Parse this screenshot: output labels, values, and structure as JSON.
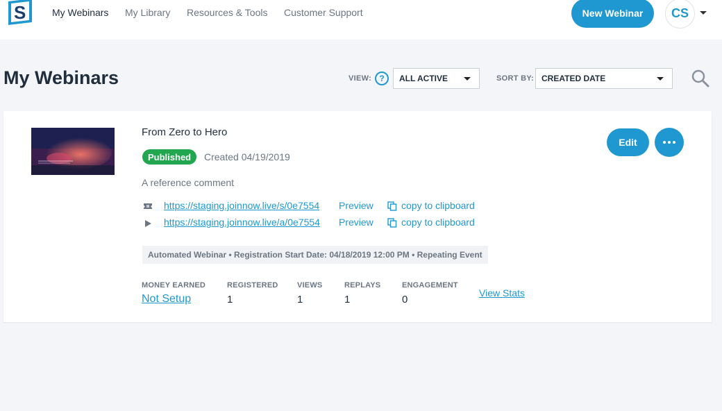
{
  "nav": {
    "items": [
      {
        "label": "My Webinars",
        "active": true
      },
      {
        "label": "My Library",
        "active": false
      },
      {
        "label": "Resources & Tools",
        "active": false
      },
      {
        "label": "Customer Support",
        "active": false
      }
    ],
    "new_webinar_label": "New Webinar",
    "avatar_initials": "CS"
  },
  "header": {
    "title": "My Webinars",
    "view_label": "VIEW:",
    "view_value": "ALL ACTIVE",
    "sort_label": "SORT BY:",
    "sort_value": "CREATED DATE"
  },
  "webinar": {
    "title": "From Zero to Hero",
    "status": "Published",
    "created": "Created 04/19/2019",
    "comment": "A reference comment",
    "links": [
      {
        "icon": "ticket-icon",
        "url": "https://staging.joinnow.live/s/0e7554",
        "preview_label": "Preview",
        "copy_label": "copy to clipboard"
      },
      {
        "icon": "play-icon",
        "url": "https://staging.joinnow.live/a/0e7554",
        "preview_label": "Preview",
        "copy_label": "copy to clipboard"
      }
    ],
    "info": "Automated Webinar • Registration Start Date: 04/18/2019 12:00 PM • Repeating Event",
    "stats": {
      "money_label": "MONEY EARNED",
      "money_value": "Not Setup",
      "registered_label": "REGISTERED",
      "registered_value": "1",
      "views_label": "VIEWS",
      "views_value": "1",
      "replays_label": "REPLAYS",
      "replays_value": "1",
      "engagement_label": "ENGAGEMENT",
      "engagement_value": "0",
      "view_stats_label": "View Stats"
    },
    "edit_label": "Edit"
  },
  "colors": {
    "accent": "#1f98d1",
    "published": "#22a650",
    "background": "#f3f5f9"
  }
}
